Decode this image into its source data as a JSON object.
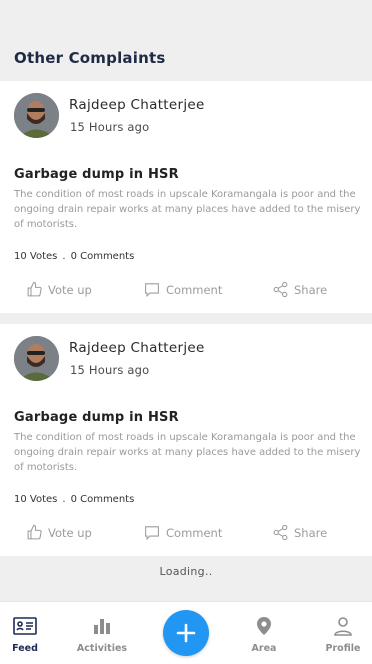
{
  "section_title": "Other Complaints",
  "complaints": [
    {
      "author": "Rajdeep Chatterjee",
      "time": "15 Hours ago",
      "title": "Garbage dump in HSR",
      "body": "The condition of most roads in upscale Koramangala is poor and the ongoing drain repair works at many places have added to the misery of motorists.",
      "votes": "10 Votes",
      "comments": "0 Comments",
      "actions": {
        "vote": "Vote up",
        "comment": "Comment",
        "share": "Share"
      }
    },
    {
      "author": "Rajdeep Chatterjee",
      "time": "15 Hours ago",
      "title": "Garbage dump in HSR",
      "body": "The condition of most roads in upscale Koramangala is poor and the ongoing drain repair works at many places have added to the misery of motorists.",
      "votes": "10 Votes",
      "comments": "0 Comments",
      "actions": {
        "vote": "Vote up",
        "comment": "Comment",
        "share": "Share"
      }
    }
  ],
  "loading_text": "Loading..",
  "nav": {
    "items": [
      {
        "label": "Feed",
        "icon": "feed-icon",
        "active": true
      },
      {
        "label": "Activities",
        "icon": "activities-icon"
      },
      {
        "label": "Area",
        "icon": "location-pin-icon"
      },
      {
        "label": "Profile",
        "icon": "profile-icon"
      }
    ],
    "fab_icon": "plus-icon"
  },
  "colors": {
    "accent": "#2196f3",
    "active_nav": "#1d2b55",
    "muted": "#9c9c9c"
  }
}
